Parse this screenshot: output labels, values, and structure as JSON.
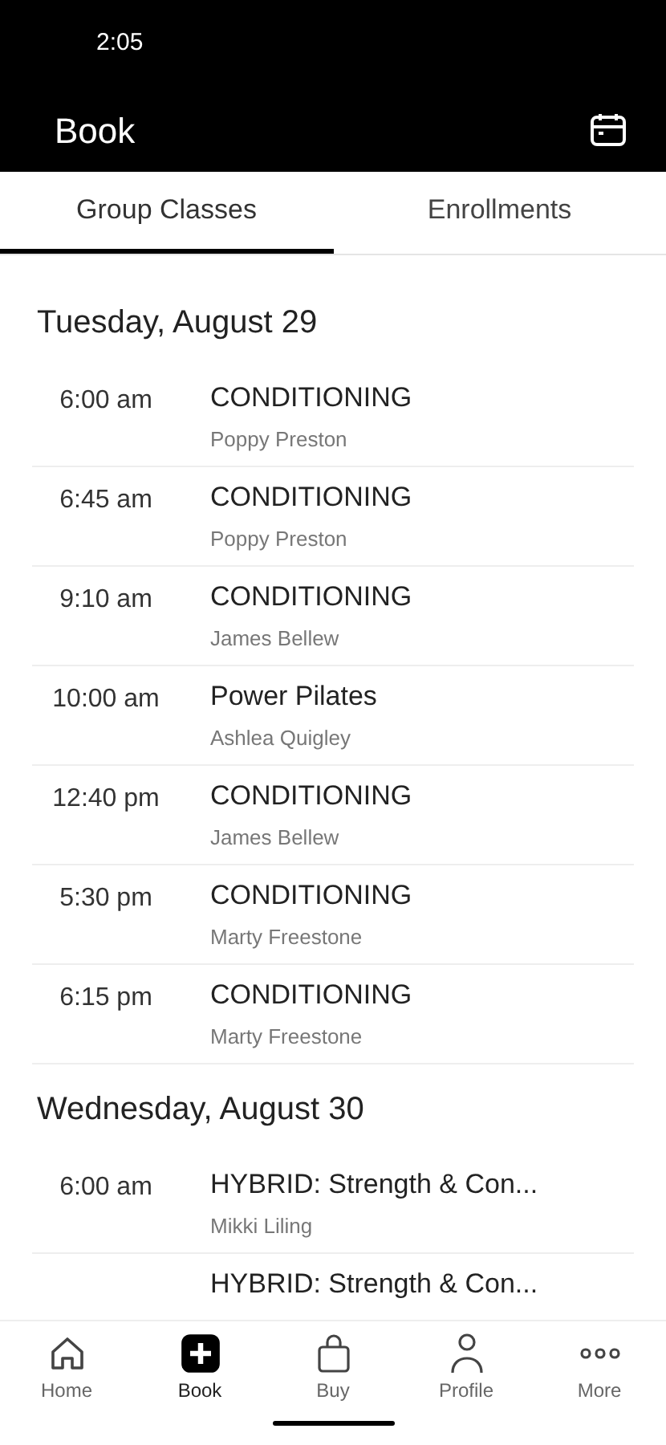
{
  "status_bar": {
    "time": "2:05"
  },
  "header": {
    "title": "Book"
  },
  "tabs": [
    {
      "label": "Group Classes",
      "selected": true
    },
    {
      "label": "Enrollments",
      "selected": false
    }
  ],
  "days": [
    {
      "date": "Tuesday, August 29",
      "classes": [
        {
          "time": "6:00 am",
          "title": "CONDITIONING",
          "instructor": "Poppy Preston"
        },
        {
          "time": "6:45 am",
          "title": "CONDITIONING",
          "instructor": "Poppy Preston"
        },
        {
          "time": "9:10 am",
          "title": "CONDITIONING",
          "instructor": "James Bellew"
        },
        {
          "time": "10:00 am",
          "title": "Power Pilates",
          "instructor": "Ashlea Quigley"
        },
        {
          "time": "12:40 pm",
          "title": "CONDITIONING",
          "instructor": "James Bellew"
        },
        {
          "time": "5:30 pm",
          "title": "CONDITIONING",
          "instructor": "Marty Freestone"
        },
        {
          "time": "6:15 pm",
          "title": "CONDITIONING",
          "instructor": "Marty Freestone"
        }
      ]
    },
    {
      "date": "Wednesday, August 30",
      "classes": [
        {
          "time": "6:00 am",
          "title": "HYBRID: Strength & Con...",
          "instructor": "Mikki Liling"
        },
        {
          "title": "HYBRID: Strength & Con..."
        }
      ]
    }
  ],
  "nav": [
    {
      "label": "Home",
      "kind": "home",
      "selected": false
    },
    {
      "label": "Book",
      "kind": "book",
      "selected": true
    },
    {
      "label": "Buy",
      "kind": "buy",
      "selected": false
    },
    {
      "label": "Profile",
      "kind": "profile",
      "selected": false
    },
    {
      "label": "More",
      "kind": "more",
      "selected": false
    }
  ]
}
